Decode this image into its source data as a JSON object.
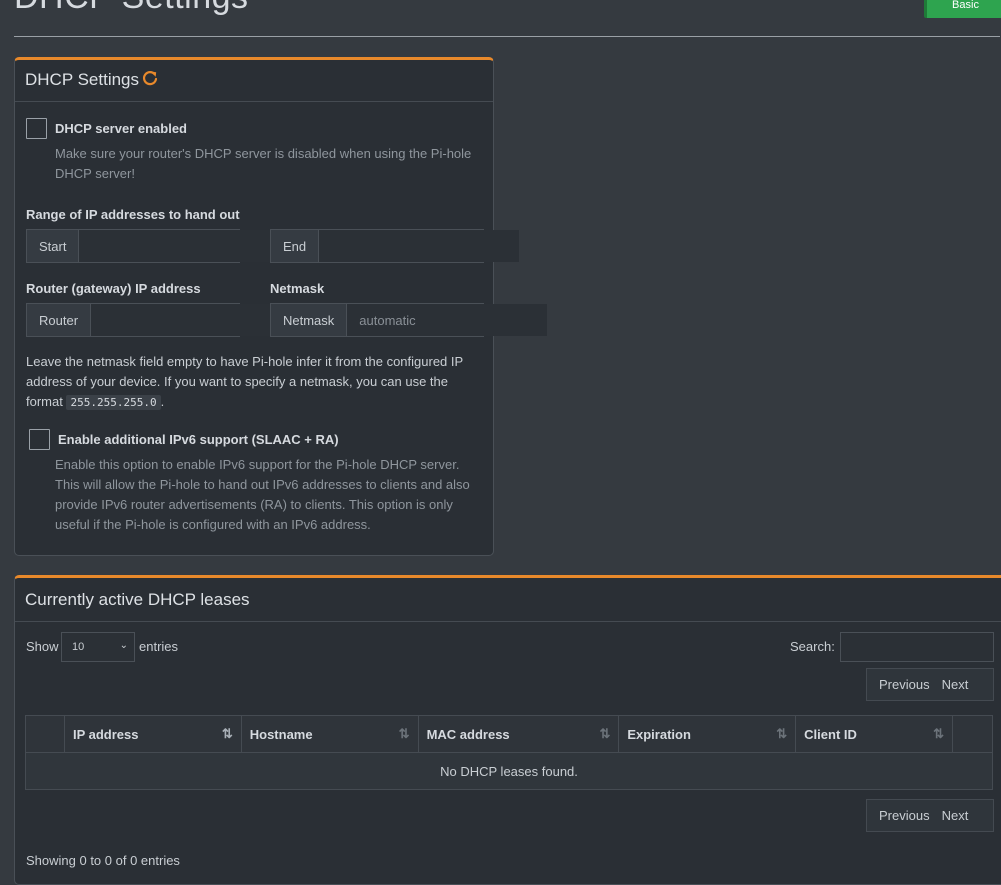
{
  "page": {
    "title": "DHCP Settings",
    "mode_button": "Basic"
  },
  "dhcp_box": {
    "title": "DHCP Settings",
    "refresh_icon": "refresh-icon",
    "server_enabled_label": "DHCP server enabled",
    "server_enabled_help_1": "Make sure your router's DHCP server is disabled when using the Pi-hole",
    "server_enabled_help_2": "DHCP server!",
    "range_label": "Range of IP addresses to hand out",
    "start_addon": "Start",
    "start_value": "",
    "end_addon": "End",
    "end_value": "",
    "router_label": "Router (gateway) IP address",
    "router_addon": "Router",
    "router_value": "",
    "netmask_label": "Netmask",
    "netmask_addon": "Netmask",
    "netmask_placeholder": "automatic",
    "netmask_help_1": "Leave the netmask field empty to have Pi-hole infer it from the configured IP",
    "netmask_help_2": "address of your device. If you want to specify a netmask, you can use the",
    "netmask_help_3_prefix": "format",
    "netmask_help_code": "255.255.255.0",
    "netmask_help_3_suffix": ".",
    "ipv6_label": "Enable additional IPv6 support (SLAAC + RA)",
    "ipv6_help_1": "Enable this option to enable IPv6 support for the Pi-hole DHCP server.",
    "ipv6_help_2": "This will allow the Pi-hole to hand out IPv6 addresses to clients and also",
    "ipv6_help_3": "provide IPv6 router advertisements (RA) to clients. This option is only",
    "ipv6_help_4": "useful if the Pi-hole is configured with an IPv6 address."
  },
  "leases_box": {
    "title": "Currently active DHCP leases",
    "show_label": "Show",
    "entries_value": "10",
    "entries_label": "entries",
    "search_label": "Search:",
    "search_value": "",
    "previous": "Previous",
    "next": "Next",
    "columns": [
      "IP address",
      "Hostname",
      "MAC address",
      "Expiration",
      "Client ID"
    ],
    "empty_message": "No DHCP leases found.",
    "info": "Showing 0 to 0 of 0 entries"
  },
  "colors": {
    "accent": "#e8892b",
    "basic_button": "#2ea44f",
    "background": "#353a40",
    "panel": "#2a2f35"
  }
}
